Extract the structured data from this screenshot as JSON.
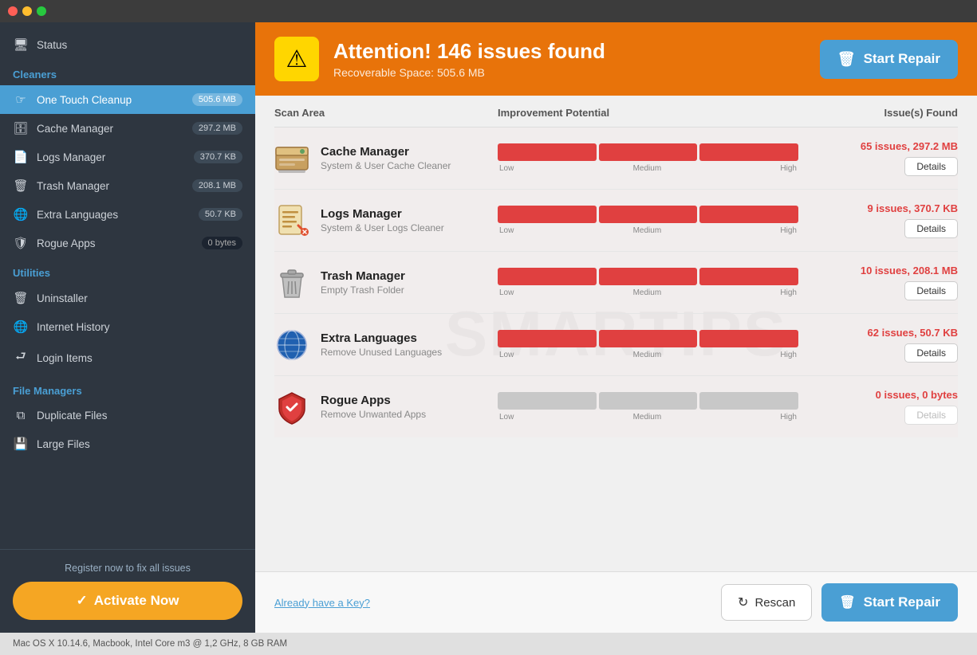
{
  "titlebar": {
    "lights": [
      "red",
      "yellow",
      "green"
    ]
  },
  "sidebar": {
    "status_label": "Status",
    "sections": [
      {
        "label": "Cleaners",
        "items": [
          {
            "id": "one-touch-cleanup",
            "label": "One Touch Cleanup",
            "badge": "505.6 MB",
            "active": true,
            "icon": "hand-pointer"
          },
          {
            "id": "cache-manager",
            "label": "Cache Manager",
            "badge": "297.2 MB",
            "active": false,
            "icon": "database"
          },
          {
            "id": "logs-manager",
            "label": "Logs Manager",
            "badge": "370.7 KB",
            "active": false,
            "icon": "file-text"
          },
          {
            "id": "trash-manager",
            "label": "Trash Manager",
            "badge": "208.1 MB",
            "active": false,
            "icon": "trash"
          },
          {
            "id": "extra-languages",
            "label": "Extra Languages",
            "badge": "50.7 KB",
            "active": false,
            "icon": "globe"
          },
          {
            "id": "rogue-apps",
            "label": "Rogue Apps",
            "badge": "0 bytes",
            "active": false,
            "icon": "shield",
            "badge_dark": true
          }
        ]
      },
      {
        "label": "Utilities",
        "items": [
          {
            "id": "uninstaller",
            "label": "Uninstaller",
            "badge": "",
            "active": false,
            "icon": "trash-alt"
          },
          {
            "id": "internet-history",
            "label": "Internet History",
            "badge": "",
            "active": false,
            "icon": "globe"
          },
          {
            "id": "login-items",
            "label": "Login Items",
            "badge": "",
            "active": false,
            "icon": "sign-in"
          }
        ]
      },
      {
        "label": "File Managers",
        "items": [
          {
            "id": "duplicate-files",
            "label": "Duplicate Files",
            "badge": "",
            "active": false,
            "icon": "copy"
          },
          {
            "id": "large-files",
            "label": "Large Files",
            "badge": "",
            "active": false,
            "icon": "hdd"
          }
        ]
      }
    ],
    "bottom": {
      "register_text": "Register now to fix all issues",
      "activate_label": "Activate Now"
    }
  },
  "alert": {
    "icon": "⚠",
    "title": "Attention! 146 issues found",
    "subtitle": "Recoverable Space: 505.6 MB",
    "button_label": "Start Repair"
  },
  "table": {
    "headers": [
      "Scan Area",
      "Improvement Potential",
      "Issue(s) Found"
    ],
    "rows": [
      {
        "id": "cache-manager",
        "name": "Cache Manager",
        "desc": "System & User Cache Cleaner",
        "bar_filled": 3,
        "bar_total": 3,
        "result_text": "65 issues, 297.2 MB",
        "details_label": "Details",
        "details_enabled": true,
        "bar_grey": false
      },
      {
        "id": "logs-manager",
        "name": "Logs Manager",
        "desc": "System & User Logs Cleaner",
        "bar_filled": 3,
        "bar_total": 3,
        "result_text": "9 issues, 370.7 KB",
        "details_label": "Details",
        "details_enabled": true,
        "bar_grey": false
      },
      {
        "id": "trash-manager",
        "name": "Trash Manager",
        "desc": "Empty Trash Folder",
        "bar_filled": 3,
        "bar_total": 3,
        "result_text": "10 issues, 208.1 MB",
        "details_label": "Details",
        "details_enabled": true,
        "bar_grey": false
      },
      {
        "id": "extra-languages",
        "name": "Extra Languages",
        "desc": "Remove Unused Languages",
        "bar_filled": 3,
        "bar_total": 3,
        "result_text": "62 issues, 50.7 KB",
        "details_label": "Details",
        "details_enabled": true,
        "bar_grey": false
      },
      {
        "id": "rogue-apps",
        "name": "Rogue Apps",
        "desc": "Remove Unwanted Apps",
        "bar_filled": 0,
        "bar_total": 3,
        "result_text": "0 issues, 0 bytes",
        "details_label": "Details",
        "details_enabled": false,
        "bar_grey": true
      }
    ]
  },
  "bottom_bar": {
    "already_key_label": "Already have a Key?",
    "rescan_label": "Rescan",
    "start_repair_label": "Start Repair"
  },
  "status_bar": {
    "text": "Mac OS X 10.14.6, Macbook, Intel Core m3 @ 1,2 GHz, 8 GB RAM"
  },
  "icons": {
    "warning": "⚠",
    "trash_btn": "🗑",
    "hand": "☞",
    "rescan": "↻",
    "check": "✓"
  }
}
